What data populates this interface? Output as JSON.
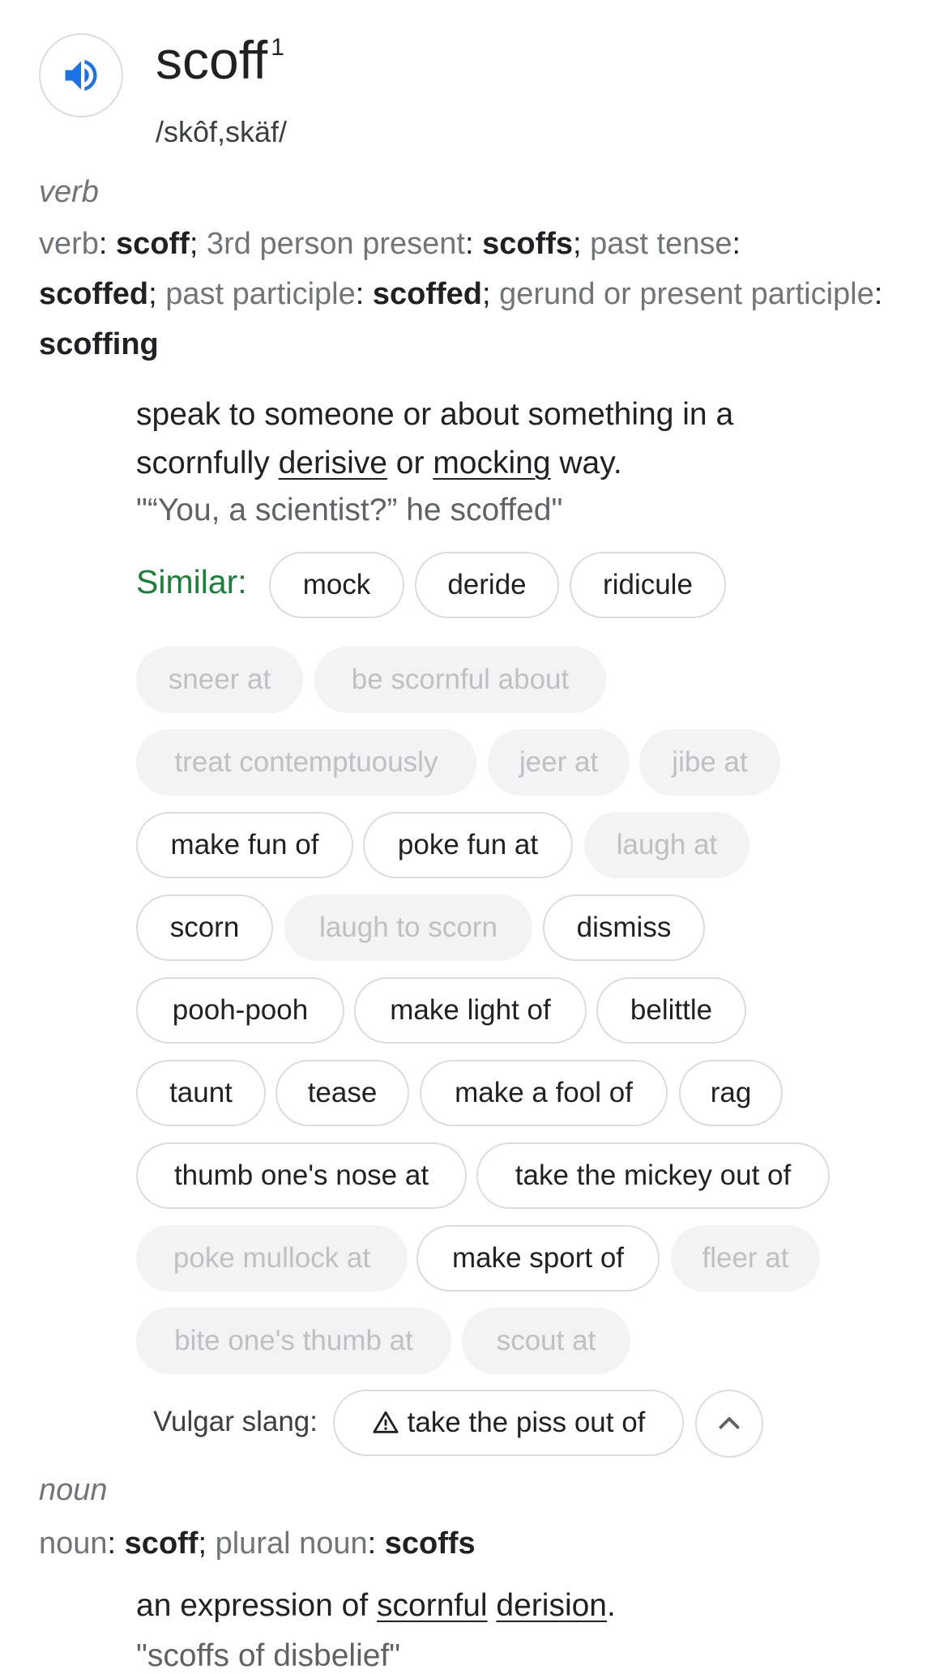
{
  "entry": {
    "word": "scoff",
    "superscript": "1",
    "phonetic": "/skôf,skäf/",
    "speaker_icon": "volume-icon"
  },
  "verb": {
    "pos": "verb",
    "forms": [
      {
        "label": "verb",
        "value": "scoff"
      },
      {
        "label": "3rd person present",
        "value": "scoffs"
      },
      {
        "label": "past tense",
        "value": "scoffed"
      },
      {
        "label": "past participle",
        "value": "scoffed"
      },
      {
        "label": "gerund or present participle",
        "value": "scoffing"
      }
    ],
    "definition": {
      "part1": "speak to someone or about something in a scornfully ",
      "link1": "derisive",
      "part2": " or ",
      "link2": "mocking",
      "part3": " way."
    },
    "example": "\"“You, a scientist?” he scoffed\"",
    "similar_label": "Similar:",
    "similar_chips": [
      {
        "label": "mock",
        "muted": false
      },
      {
        "label": "deride",
        "muted": false
      },
      {
        "label": "ridicule",
        "muted": false
      },
      {
        "label": "sneer at",
        "muted": true
      },
      {
        "label": "be scornful about",
        "muted": true
      },
      {
        "label": "treat contemptuously",
        "muted": true
      },
      {
        "label": "jeer at",
        "muted": true
      },
      {
        "label": "jibe at",
        "muted": true
      },
      {
        "label": "make fun of",
        "muted": false
      },
      {
        "label": "poke fun at",
        "muted": false
      },
      {
        "label": "laugh at",
        "muted": true
      },
      {
        "label": "scorn",
        "muted": false
      },
      {
        "label": "laugh to scorn",
        "muted": true
      },
      {
        "label": "dismiss",
        "muted": false
      },
      {
        "label": "pooh-pooh",
        "muted": false
      },
      {
        "label": "make light of",
        "muted": false
      },
      {
        "label": "belittle",
        "muted": false
      },
      {
        "label": "taunt",
        "muted": false
      },
      {
        "label": "tease",
        "muted": false
      },
      {
        "label": "make a fool of",
        "muted": false
      },
      {
        "label": "rag",
        "muted": false
      },
      {
        "label": "thumb one's nose at",
        "muted": false
      },
      {
        "label": "take the mickey out of",
        "muted": false
      },
      {
        "label": "poke mullock at",
        "muted": true
      },
      {
        "label": "make sport of",
        "muted": false
      },
      {
        "label": "fleer at",
        "muted": true
      },
      {
        "label": "bite one's thumb at",
        "muted": true
      },
      {
        "label": "scout at",
        "muted": true
      }
    ],
    "vulgar_label": "Vulgar slang:",
    "vulgar_chip": "take the piss out of",
    "vulgar_icon": "warning-icon",
    "collapse_icon": "chevron-up-icon"
  },
  "noun": {
    "pos": "noun",
    "forms": [
      {
        "label": "noun",
        "value": "scoff"
      },
      {
        "label": "plural noun",
        "value": "scoffs"
      }
    ],
    "definition": {
      "part1": "an expression of ",
      "link1": "scornful",
      "part2": " ",
      "link2": "derision",
      "part3": "."
    },
    "example": "\"scoffs of disbelief\""
  },
  "colors": {
    "accent_blue": "#1a73e8",
    "similar_green": "#188038",
    "muted_text": "#70757a",
    "chip_border": "#dadce0",
    "muted_chip_bg": "#f1f3f4"
  }
}
